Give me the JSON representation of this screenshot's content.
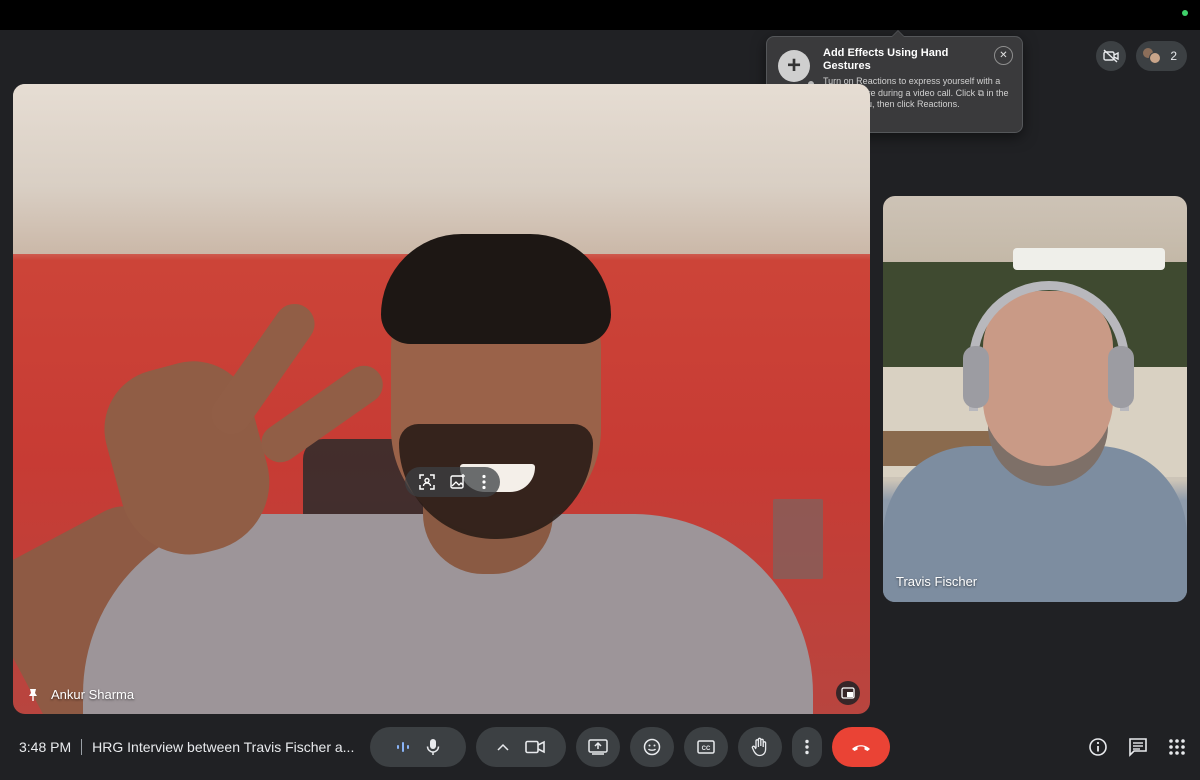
{
  "window": {
    "status_dot_color": "#3fd16b"
  },
  "top_right": {
    "camera_off_icon": "camera-off-icon",
    "participant_count": "2"
  },
  "popup": {
    "title": "Add Effects Using Hand Gestures",
    "body": "Turn on Reactions to express yourself with a hand gesture during a video call. Click ⧉ in the status menu, then click Reactions.",
    "icon": "plus-icon",
    "close_label": "✕"
  },
  "main_tile": {
    "participant_name": "Ankur Sharma",
    "pinned_icon": "pin-icon",
    "overlay_icons": [
      "frame-person-icon",
      "background-effects-icon",
      "more-vert-icon"
    ],
    "expand_icon": "picture-in-picture-icon"
  },
  "side_tile": {
    "participant_name": "Travis Fischer"
  },
  "bottom_bar": {
    "time": "3:48 PM",
    "meeting_title": "HRG Interview between Travis Fischer a...",
    "controls": [
      {
        "name": "audio-levels",
        "icon": "audio-wave-icon"
      },
      {
        "name": "microphone",
        "icon": "mic-icon"
      },
      {
        "name": "video-options",
        "icon": "chevron-up-icon"
      },
      {
        "name": "camera",
        "icon": "videocam-icon"
      },
      {
        "name": "present",
        "icon": "present-screen-icon"
      },
      {
        "name": "reactions",
        "icon": "emoji-icon"
      },
      {
        "name": "captions",
        "icon": "closed-caption-icon"
      },
      {
        "name": "raise-hand",
        "icon": "hand-icon"
      },
      {
        "name": "more-options",
        "icon": "more-vert-icon"
      },
      {
        "name": "leave-call",
        "icon": "call-end-icon"
      }
    ],
    "right_icons": [
      "info-icon",
      "chat-icon",
      "apps-grid-icon"
    ],
    "end_call_color": "#ea4335"
  }
}
